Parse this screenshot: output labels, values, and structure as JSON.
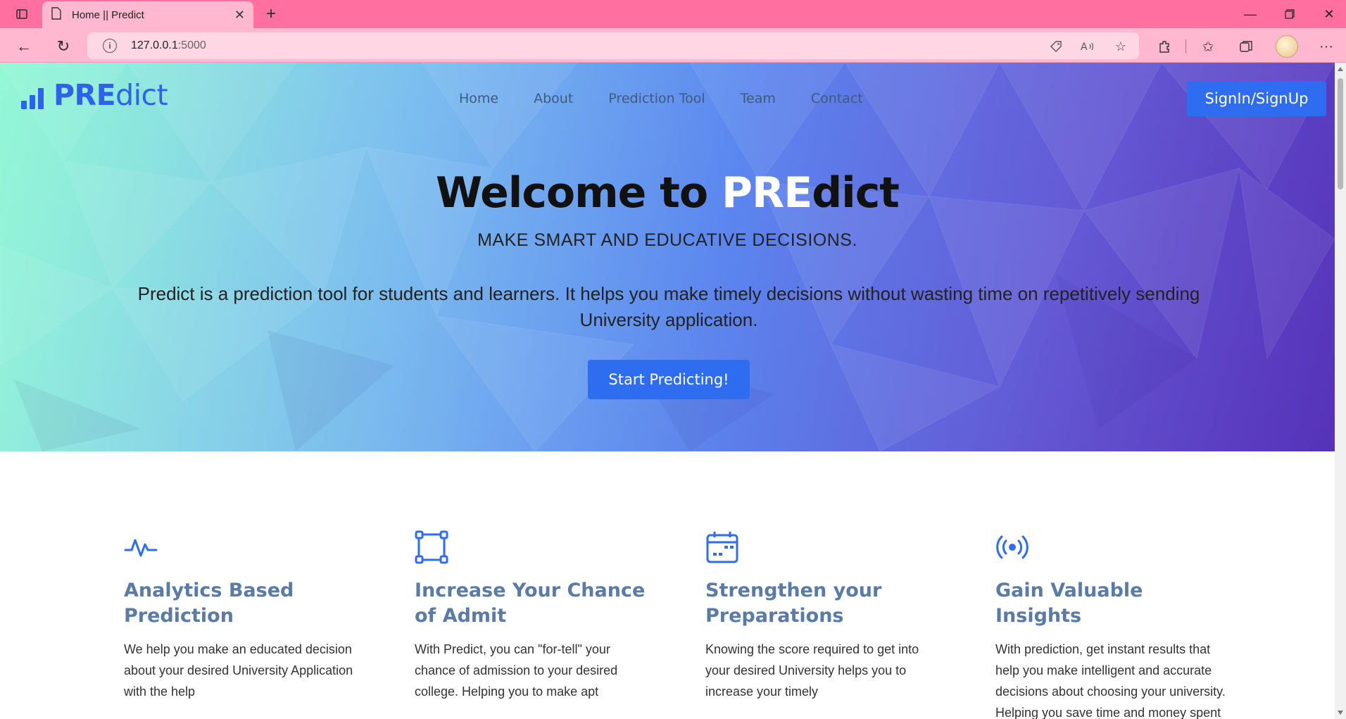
{
  "browser": {
    "tab_title": "Home || Predict",
    "url_host": "127.0.0.1",
    "url_port": ":5000"
  },
  "nav": {
    "brand_bold": "PRE",
    "brand_rest": "dict",
    "items": [
      "Home",
      "About",
      "Prediction Tool",
      "Team",
      "Contact"
    ],
    "signin": "SignIn/SignUp"
  },
  "hero": {
    "title_pre": "Welcome to ",
    "title_hl": "PRE",
    "title_post": "dict",
    "subtitle": "MAKE SMART AND EDUCATIVE DECISIONS.",
    "description": "Predict is a prediction tool for students and learners. It helps you make timely decisions without wasting time on repetitively sending University application.",
    "cta": "Start Predicting!"
  },
  "features": [
    {
      "icon": "pulse-icon",
      "title": "Analytics Based Prediction",
      "text": "We help you make an educated decision about your desired University Application with the help"
    },
    {
      "icon": "bounding-box-icon",
      "title": "Increase Your Chance of Admit",
      "text": "With Predict, you can \"for-tell\" your chance of admission to your desired college. Helping you to make apt"
    },
    {
      "icon": "calendar-icon",
      "title": "Strengthen your Preparations",
      "text": "Knowing the score required to get into your desired University helps you to increase your timely"
    },
    {
      "icon": "broadcast-icon",
      "title": "Gain Valuable Insights",
      "text": "With prediction, get instant results that help you make intelligent and accurate decisions about choosing your university. Helping you save time and money spent on"
    }
  ],
  "colors": {
    "accent": "#2f6df0",
    "feature_title": "#5a7ba6",
    "browser_frame": "#ff6fa0"
  }
}
